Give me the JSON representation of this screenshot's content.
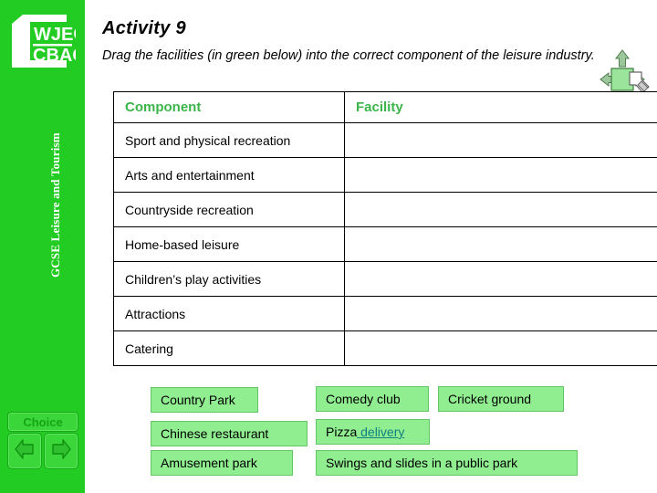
{
  "sidebar": {
    "logo": {
      "name": "wjec-cbac-logo",
      "line1": "WJEC",
      "line2": "CBAC"
    },
    "course_title": "GCSE Leisure and Tourism",
    "choice_button_label": "Choice",
    "nav": {
      "back_label": "Back",
      "forward_label": "Forward"
    },
    "background_color": "#22cc22"
  },
  "header": {
    "title": "Activity 9",
    "instruction": "Drag the facilities (in green below) into the correct component of the leisure industry.",
    "drag_handle_icon": "drag-move-hand-icon"
  },
  "table": {
    "columns": [
      "Component",
      "Facility"
    ],
    "header_color": "#3bb54a",
    "rows": [
      {
        "component": "Sport and physical recreation",
        "facility": ""
      },
      {
        "component": "Arts and entertainment",
        "facility": ""
      },
      {
        "component": "Countryside recreation",
        "facility": ""
      },
      {
        "component": "Home-based leisure",
        "facility": ""
      },
      {
        "component": "Children’s play activities",
        "facility": ""
      },
      {
        "component": "Attractions",
        "facility": ""
      },
      {
        "component": "Catering",
        "facility": ""
      }
    ]
  },
  "facility_chips": {
    "fill_color": "#90ee90",
    "items": [
      {
        "id": "country-park",
        "label": "Country Park"
      },
      {
        "id": "chinese-rest",
        "label": "Chinese restaurant"
      },
      {
        "id": "amusement-park",
        "label": "Amusement park"
      },
      {
        "id": "comedy-club",
        "label": "Comedy club"
      },
      {
        "id": "cricket-ground",
        "label": "Cricket ground"
      },
      {
        "id": "pizza-delivery",
        "label_plain": "Pizza",
        "label_link": " delivery",
        "link_color": "#108080"
      },
      {
        "id": "swings-slides",
        "label": "Swings and slides in a public park"
      }
    ]
  }
}
